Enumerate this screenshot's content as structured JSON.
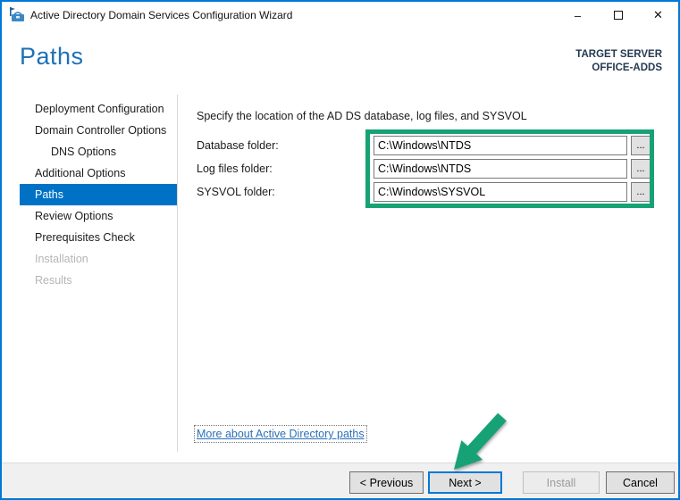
{
  "window": {
    "title": "Active Directory Domain Services Configuration Wizard",
    "controls": {
      "minimize": "–",
      "close": "✕"
    }
  },
  "header": {
    "title": "Paths",
    "target_server_label": "TARGET SERVER",
    "target_server_name": "OFFICE-ADDS"
  },
  "sidebar": {
    "items": [
      {
        "label": "Deployment Configuration",
        "state": "enabled"
      },
      {
        "label": "Domain Controller Options",
        "state": "enabled"
      },
      {
        "label": "DNS Options",
        "state": "enabled-indented"
      },
      {
        "label": "Additional Options",
        "state": "enabled"
      },
      {
        "label": "Paths",
        "state": "selected"
      },
      {
        "label": "Review Options",
        "state": "enabled"
      },
      {
        "label": "Prerequisites Check",
        "state": "enabled"
      },
      {
        "label": "Installation",
        "state": "disabled"
      },
      {
        "label": "Results",
        "state": "disabled"
      }
    ]
  },
  "main": {
    "instruction": "Specify the location of the AD DS database, log files, and SYSVOL",
    "fields": [
      {
        "label": "Database folder:",
        "value": "C:\\Windows\\NTDS",
        "browse_label": "..."
      },
      {
        "label": "Log files folder:",
        "value": "C:\\Windows\\NTDS",
        "browse_label": "..."
      },
      {
        "label": "SYSVOL folder:",
        "value": "C:\\Windows\\SYSVOL",
        "browse_label": "..."
      }
    ],
    "link": "More about Active Directory paths"
  },
  "footer": {
    "previous_label": "< Previous",
    "next_label": "Next >",
    "install_label": "Install",
    "cancel_label": "Cancel"
  },
  "colors": {
    "accent-blue": "#0078d7",
    "heading-blue": "#1d70b8",
    "selected-blue": "#0072c6",
    "annotation-green": "#17a276",
    "link-blue": "#2a70b8"
  }
}
